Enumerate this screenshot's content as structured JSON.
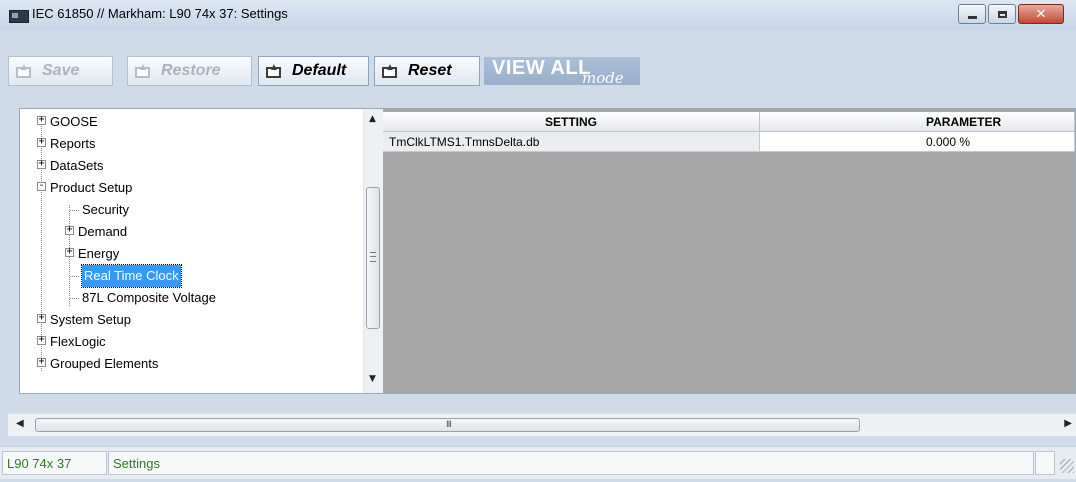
{
  "window": {
    "title": "IEC 61850 // Markham: L90 74x 37: Settings",
    "buttons": [
      "minimize-icon",
      "maximize-icon",
      "close-icon"
    ]
  },
  "toolbar": {
    "save_label": "Save",
    "restore_label": "Restore",
    "default_label": "Default",
    "reset_label": "Reset",
    "view_all_main": "VIEW ALL",
    "view_all_mode": "mode"
  },
  "tree": {
    "items": [
      {
        "label": "GOOSE",
        "expander": "+",
        "level": 0
      },
      {
        "label": "Reports",
        "expander": "+",
        "level": 0
      },
      {
        "label": "DataSets",
        "expander": "+",
        "level": 0
      },
      {
        "label": "Product Setup",
        "expander": "-",
        "level": 0
      },
      {
        "label": "Security",
        "expander": "",
        "level": 1
      },
      {
        "label": "Demand",
        "expander": "+",
        "level": 1
      },
      {
        "label": "Energy",
        "expander": "+",
        "level": 1
      },
      {
        "label": "Real Time Clock",
        "expander": "",
        "level": 1,
        "selected": true
      },
      {
        "label": "87L Composite Voltage",
        "expander": "",
        "level": 1
      },
      {
        "label": "System Setup",
        "expander": "+",
        "level": 0
      },
      {
        "label": "FlexLogic",
        "expander": "+",
        "level": 0
      },
      {
        "label": "Grouped Elements",
        "expander": "+",
        "level": 0
      }
    ]
  },
  "grid": {
    "headers": {
      "setting": "SETTING",
      "parameter": "PARAMETER"
    },
    "rows": [
      {
        "setting": "TmClkLTMS1.TmnsDelta.db",
        "parameter": "0.000 %"
      }
    ]
  },
  "hscroll": {
    "grip": "III"
  },
  "statusbar": {
    "device": "L90 74x 37",
    "section": "Settings"
  },
  "colors": {
    "selection": "#3399ff",
    "status_text": "#2f7a1f",
    "grid_background": "#a7a7a7",
    "window_frame": "#cfdbe8"
  }
}
